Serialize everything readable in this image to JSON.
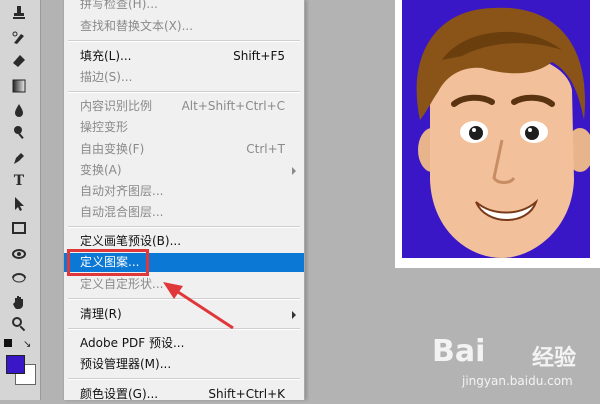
{
  "menu": {
    "items": [
      {
        "label": "拼写检查(H)...",
        "shortcut": "",
        "state": "disabled"
      },
      {
        "label": "查找和替换文本(X)...",
        "shortcut": "",
        "state": "disabled"
      },
      {
        "label": "填充(L)...",
        "shortcut": "Shift+F5",
        "state": "enabled"
      },
      {
        "label": "描边(S)...",
        "shortcut": "",
        "state": "disabled"
      },
      {
        "label": "内容识别比例",
        "shortcut": "Alt+Shift+Ctrl+C",
        "state": "disabled"
      },
      {
        "label": "操控变形",
        "shortcut": "",
        "state": "disabled"
      },
      {
        "label": "自由变换(F)",
        "shortcut": "Ctrl+T",
        "state": "disabled"
      },
      {
        "label": "变换(A)",
        "shortcut": "",
        "state": "disabled"
      },
      {
        "label": "自动对齐图层...",
        "shortcut": "",
        "state": "disabled"
      },
      {
        "label": "自动混合图层...",
        "shortcut": "",
        "state": "disabled"
      },
      {
        "label": "定义画笔预设(B)...",
        "shortcut": "",
        "state": "enabled"
      },
      {
        "label": "定义图案...",
        "shortcut": "",
        "state": "highlighted"
      },
      {
        "label": "定义自定形状...",
        "shortcut": "",
        "state": "disabled"
      },
      {
        "label": "清理(R)",
        "shortcut": "",
        "state": "enabled"
      },
      {
        "label": "Adobe PDF 预设...",
        "shortcut": "",
        "state": "enabled"
      },
      {
        "label": "预设管理器(M)...",
        "shortcut": "",
        "state": "enabled"
      },
      {
        "label": "颜色设置(G)...",
        "shortcut": "Shift+Ctrl+K",
        "state": "enabled"
      }
    ]
  },
  "colors": {
    "highlight": "#0a78d4",
    "annotation": "#e0373b",
    "foreground_swatch": "#3a17c6",
    "background_swatch": "#ffffff",
    "photo_background": "#3a17c6"
  },
  "watermark": {
    "brand": "Bai",
    "brand_suffix": "经验",
    "url": "jingyan.baidu.com"
  }
}
